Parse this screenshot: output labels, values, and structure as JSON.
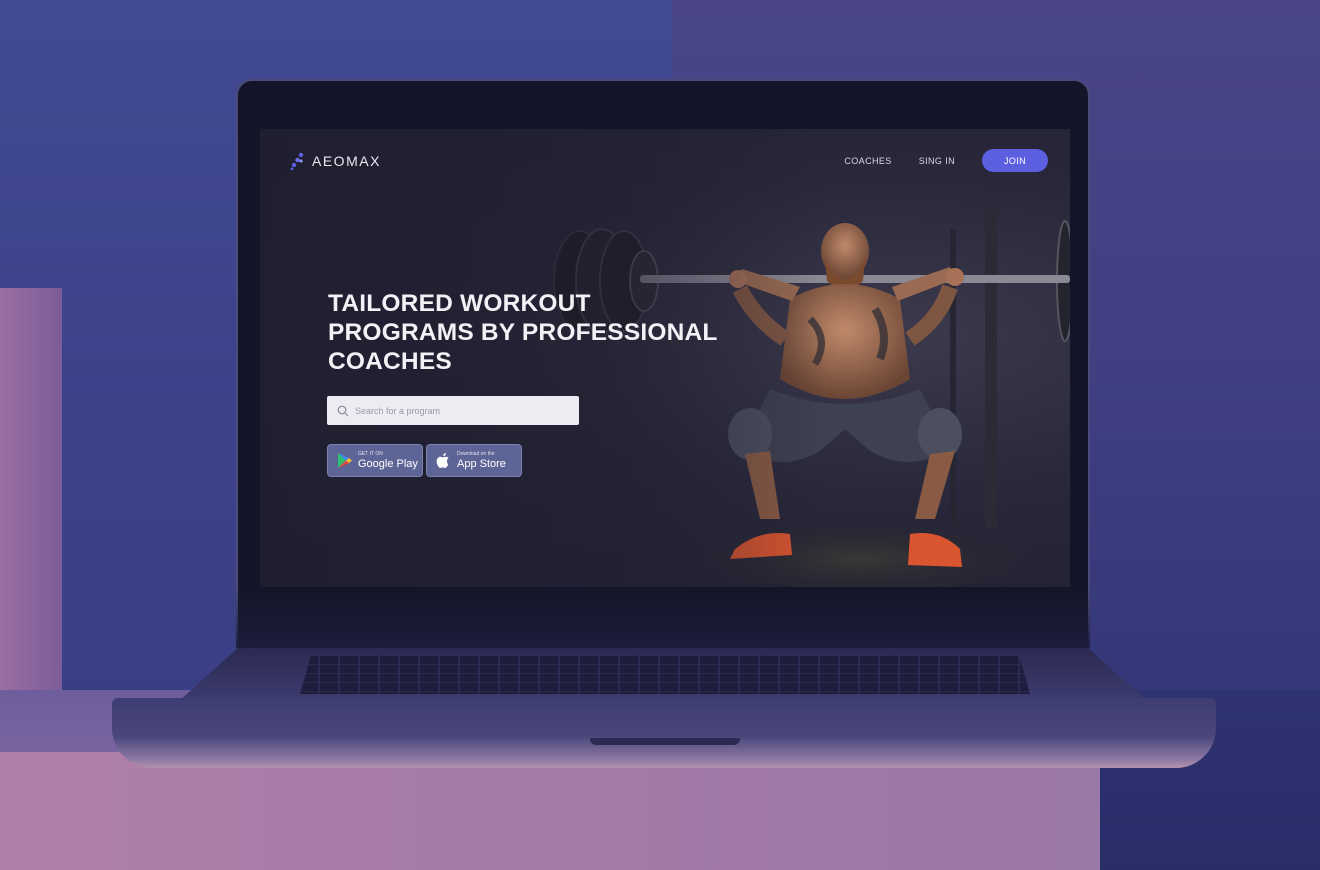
{
  "brand": {
    "name": "AEOMAX",
    "accent": "#5b5fe0"
  },
  "nav": {
    "coaches": "COACHES",
    "sign_in": "SING IN",
    "join": "JOIN"
  },
  "hero": {
    "headline_lines": [
      "TAILORED WORKOUT",
      "PROGRAMS BY PROFESSIONAL",
      "COACHES"
    ],
    "search_placeholder": "Search for a program"
  },
  "stores": {
    "google": {
      "small": "GET IT ON",
      "big": "Google Play",
      "icon": "google-play-icon"
    },
    "apple": {
      "small": "Download on the",
      "big": "App Store",
      "icon": "apple-icon"
    }
  }
}
